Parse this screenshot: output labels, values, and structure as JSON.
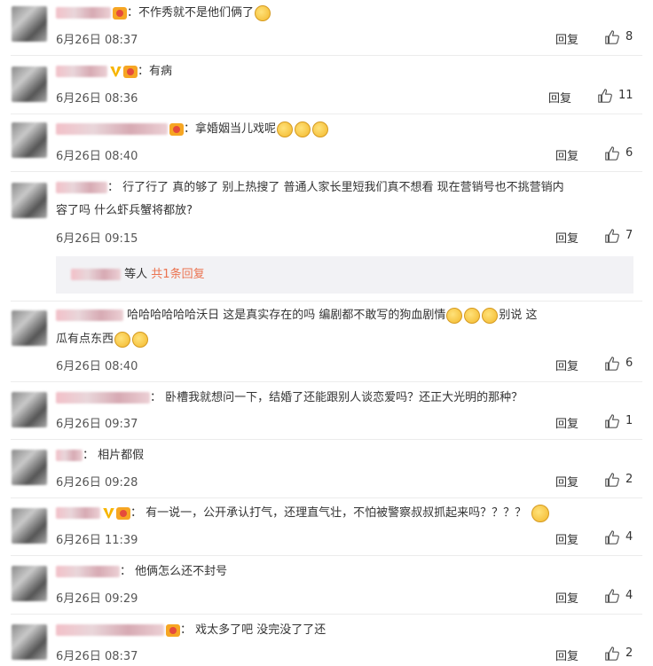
{
  "ui": {
    "reply_label": "回复",
    "sub_reply_prefix": "等人",
    "sub_reply_count": "共1条回复"
  },
  "comments": [
    {
      "text": "：不作秀就不是他们俩了",
      "time": "6月26日 08:37",
      "likes": "8"
    },
    {
      "text": "：有病",
      "time": "6月26日 08:36",
      "likes": "11"
    },
    {
      "text": "：拿婚姻当儿戏呢",
      "time": "6月26日 08:40",
      "likes": "6"
    },
    {
      "text_line1": "： 行了行了 真的够了 别上热搜了 普通人家长里短我们真不想看 现在营销号也不挑营销内",
      "text_line2": "容了吗 什么虾兵蟹将都放?",
      "time": "6月26日 09:15",
      "likes": "7"
    },
    {
      "text_line1": " 哈哈哈哈哈哈沃日 这是真实存在的吗 编剧都不敢写的狗血剧情",
      "text_line1_tail": "别说  这",
      "text_line2": "瓜有点东西",
      "time": "6月26日 08:40",
      "likes": "6"
    },
    {
      "text": "： 卧槽我就想问一下，结婚了还能跟别人谈恋爱吗？还正大光明的那种？",
      "time": "6月26日 09:37",
      "likes": "1"
    },
    {
      "text": "：  相片都假",
      "time": "6月26日 09:28",
      "likes": "2"
    },
    {
      "text": "： 有一说一，公开承认打气，还理直气壮，不怕被警察叔叔抓起来吗？？？？",
      "time": "6月26日 11:39",
      "likes": "4"
    },
    {
      "text": "：  他俩怎么还不封号",
      "time": "6月26日 09:29",
      "likes": "4"
    },
    {
      "text": "： 戏太多了吧   没完没了了还",
      "time": "6月26日 08:37",
      "likes": "2"
    }
  ],
  "colors": {
    "accent": "#eb7350",
    "vip": "#f7b500",
    "separator": "#ececec"
  }
}
